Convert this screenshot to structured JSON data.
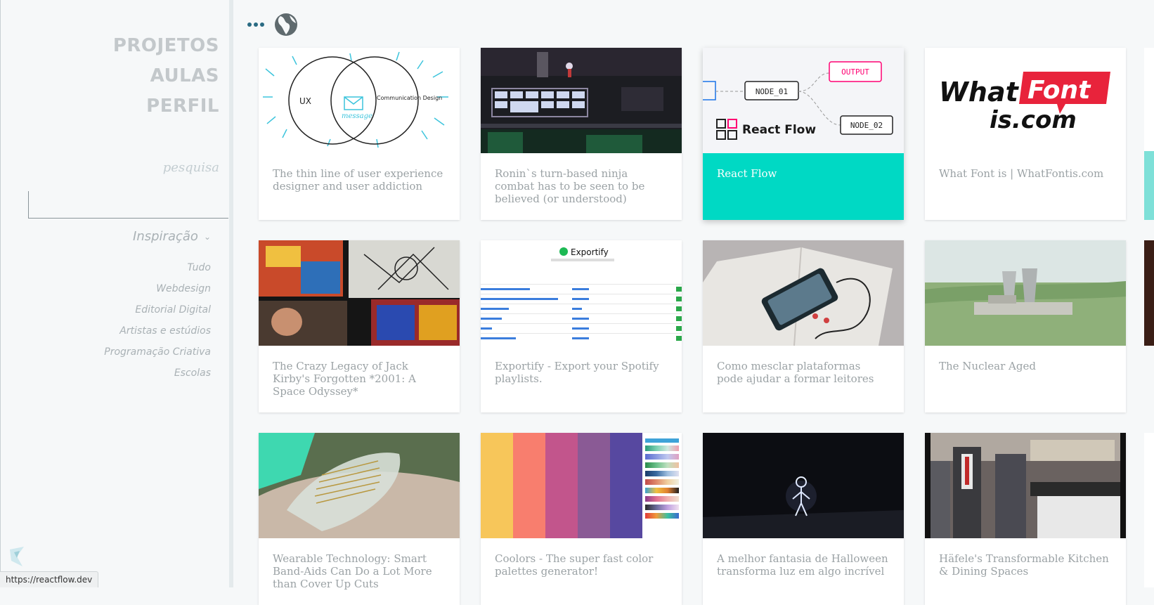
{
  "sidebar": {
    "nav": [
      "PROJETOS",
      "AULAS",
      "PERFIL"
    ],
    "search_label": "pesquisa",
    "search_value": "",
    "filter_heading": "Inspiração",
    "filters": [
      "Tudo",
      "Webdesign",
      "Editorial Digital",
      "Artistas e estúdios",
      "Programação Criativa",
      "Escolas"
    ]
  },
  "status_url": "https://reactflow.dev",
  "icons": {
    "menu": "more-dots-icon",
    "logo": "globe-logo-icon",
    "filter_toggle": "chevron-down-icon"
  },
  "colors": {
    "accent": "#00d9c4",
    "menu_dots": "#2a6b83",
    "nav_text": "#c3c8cb"
  },
  "cards": [
    {
      "title": "The thin line of user experience designer and user addiction",
      "thumb_labels": [
        "UX",
        "Communication Design",
        "message"
      ]
    },
    {
      "title": "Ronin`s turn-based ninja combat has to be seen to be believed (or understood)"
    },
    {
      "title": "React Flow",
      "thumb_labels": [
        "NODE_01",
        "OUTPUT",
        "NODE_02",
        "React Flow"
      ],
      "highlighted": true
    },
    {
      "title": "What Font is | WhatFontis.com",
      "thumb_labels": [
        "What",
        "Font",
        "is.com"
      ]
    },
    {
      "title": "The Crazy Legacy of Jack Kirby's Forgotten *2001: A Space Odyssey*"
    },
    {
      "title": "Exportify - Export your Spotify playlists.",
      "thumb_labels": [
        "Exportify"
      ]
    },
    {
      "title": "Como mesclar plataformas pode ajudar a formar leitores"
    },
    {
      "title": "The Nuclear Aged"
    },
    {
      "title": "Wearable Technology: Smart Band-Aids Can Do a Lot More than Cover Up Cuts"
    },
    {
      "title": "Coolors - The super fast color palettes generator!",
      "palette": [
        "#f7c65a",
        "#f87e6e",
        "#c2558c",
        "#8a5a95",
        "#5748a0"
      ]
    },
    {
      "title": "A melhor fantasia de Halloween transforma luz em algo incrível"
    },
    {
      "title": "Häfele's Transformable Kitchen & Dining Spaces"
    }
  ]
}
